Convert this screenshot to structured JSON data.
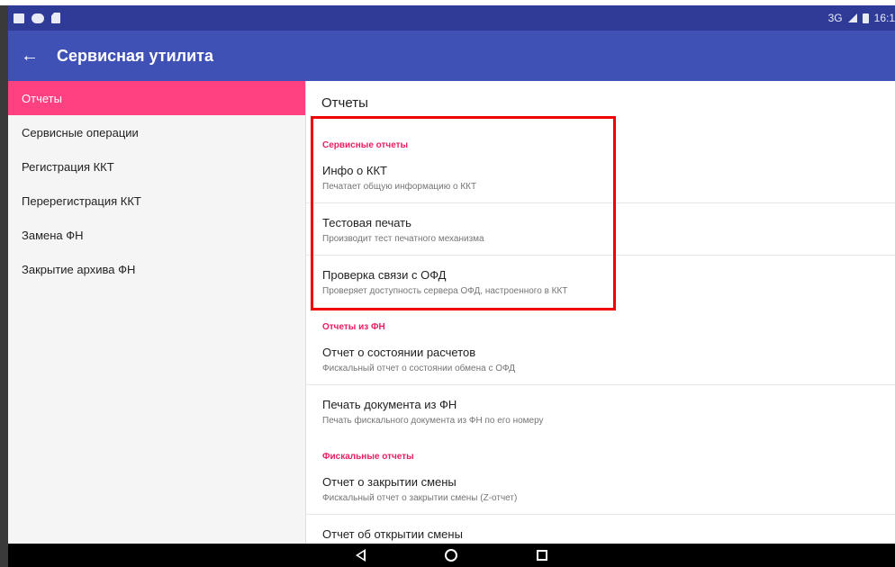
{
  "status_bar": {
    "network": "3G",
    "time": "16:1"
  },
  "app_bar": {
    "back_icon": "←",
    "title": "Сервисная утилита"
  },
  "sidebar": {
    "items": [
      {
        "label": "Отчеты",
        "active": true
      },
      {
        "label": "Сервисные операции"
      },
      {
        "label": "Регистрация ККТ"
      },
      {
        "label": "Перерегистрация ККТ"
      },
      {
        "label": "Замена ФН"
      },
      {
        "label": "Закрытие архива ФН"
      }
    ]
  },
  "content": {
    "title": "Отчеты",
    "sections": [
      {
        "header": "Сервисные отчеты",
        "items": [
          {
            "title": "Инфо о ККТ",
            "summary": "Печатает общую информацию о ККТ"
          },
          {
            "title": "Тестовая печать",
            "summary": "Производит тест печатного механизма"
          },
          {
            "title": "Проверка связи с ОФД",
            "summary": "Проверяет доступность сервера ОФД, настроенного в ККТ"
          }
        ]
      },
      {
        "header": "Отчеты из ФН",
        "items": [
          {
            "title": "Отчет о состоянии расчетов",
            "summary": "Фискальный отчет о состоянии обмена с ОФД"
          },
          {
            "title": "Печать документа из ФН",
            "summary": "Печать фискального документа из ФН по его номеру"
          }
        ]
      },
      {
        "header": "Фискальные отчеты",
        "items": [
          {
            "title": "Отчет о закрытии смены",
            "summary": "Фискальный отчет о закрытии смены (Z-отчет)"
          },
          {
            "title": "Отчет об открытии смены",
            "summary": ""
          }
        ]
      }
    ]
  },
  "colors": {
    "status_bar": "#2f3c97",
    "app_bar": "#3f51b5",
    "accent": "#ff4081",
    "section_header": "#e91e63",
    "highlight": "#f20000"
  },
  "icons": {
    "back": "arrow-left-icon",
    "nav_back": "triangle-back-icon",
    "nav_home": "circle-home-icon",
    "nav_recent": "square-recent-icon"
  }
}
